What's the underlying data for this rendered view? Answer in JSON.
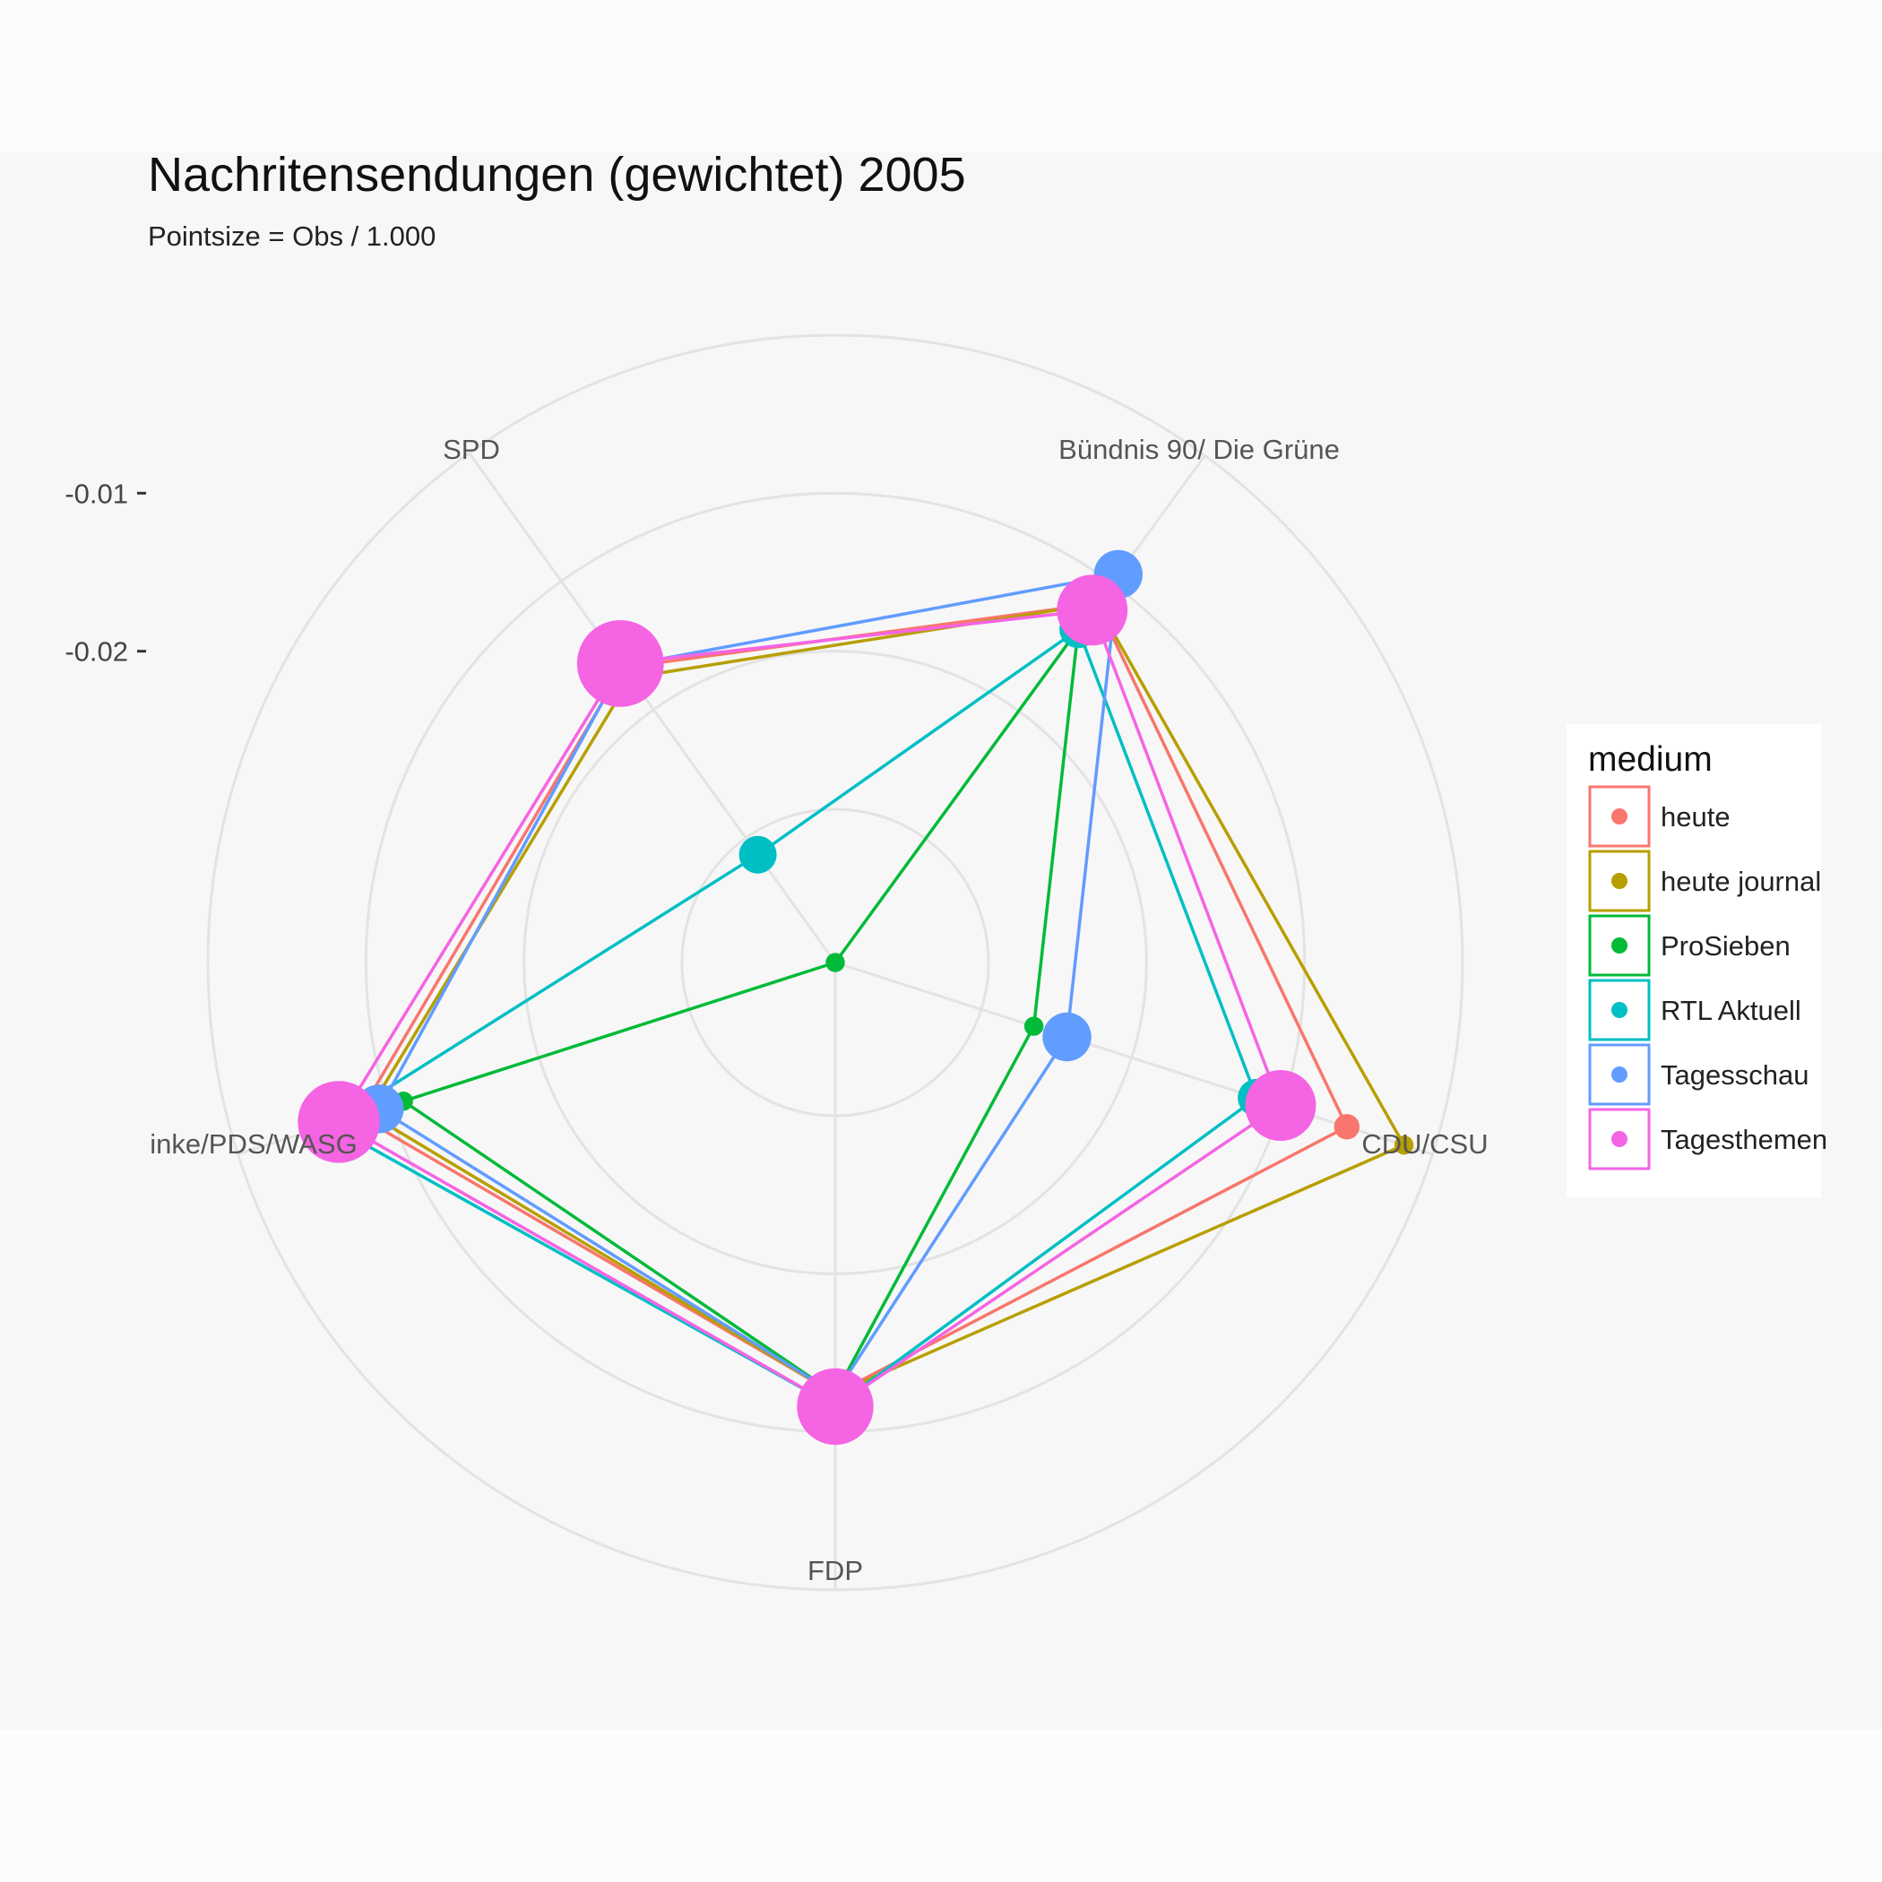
{
  "chart_data": {
    "type": "radar",
    "title": "Nachritensendungen (gewichtet) 2005",
    "subtitle": "Pointsize = Obs / 1.000",
    "axes": [
      "CDU/CSU",
      "FDP",
      "inke/PDS/WASG",
      "SPD",
      "Bündnis 90/ Die Grüne"
    ],
    "radial_ticks": [
      {
        "label": "-0.01",
        "value": -0.01
      },
      {
        "label": "-0.02",
        "value": -0.02
      }
    ],
    "grid_circles": [
      -0.03,
      -0.02,
      -0.01,
      0.0
    ],
    "rlim": [
      -0.0397,
      0.0
    ],
    "legend": {
      "title": "medium",
      "position": "right"
    },
    "series": [
      {
        "name": "heute",
        "color": "#F8766D",
        "values": [
          -0.0057,
          -0.0124,
          -0.008,
          -0.0167,
          -0.0116
        ],
        "obs": [
          0.3,
          0.3,
          0.3,
          0.3,
          0.3
        ]
      },
      {
        "name": "heute journal",
        "color": "#B79F00",
        "values": [
          -0.0019,
          -0.0124,
          -0.0086,
          -0.0175,
          -0.0116
        ],
        "obs": [
          0.1,
          0.1,
          0.1,
          0.1,
          0.1
        ]
      },
      {
        "name": "ProSieben",
        "color": "#00BA38",
        "values": [
          -0.0265,
          -0.0124,
          -0.011,
          -0.0397,
          -0.0136
        ],
        "obs": [
          0.1,
          0.1,
          0.1,
          0.1,
          0.1
        ]
      },
      {
        "name": "RTL Aktuell",
        "color": "#00BFC4",
        "values": [
          -0.0117,
          -0.0116,
          -0.0061,
          -0.0313,
          -0.0136
        ],
        "obs": [
          1.0,
          1.0,
          1.0,
          1.0,
          1.0
        ]
      },
      {
        "name": "Tagesschau",
        "color": "#619CFF",
        "values": [
          -0.0243,
          -0.0124,
          -0.0094,
          -0.0166,
          -0.0093
        ],
        "obs": [
          2.0,
          2.0,
          2.0,
          2.0,
          2.0
        ]
      },
      {
        "name": "Tagesthemen",
        "color": "#F564E3",
        "values": [
          -0.0101,
          -0.0116,
          -0.0067,
          -0.0164,
          -0.0121
        ],
        "obs": [
          5.0,
          6.0,
          7.0,
          8.0,
          5.0
        ]
      }
    ]
  }
}
